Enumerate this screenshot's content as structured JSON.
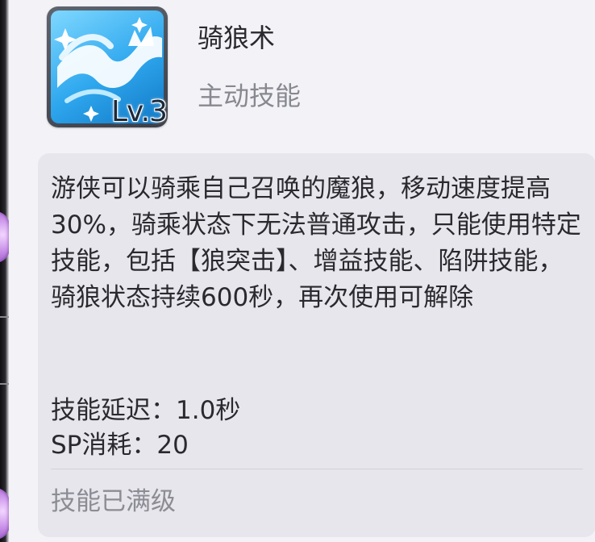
{
  "skill": {
    "icon": "wolf-ride-icon",
    "level": "Lv.3",
    "name": "骑狼术",
    "type": "主动技能"
  },
  "description": "游侠可以骑乘自己召唤的魔狼，移动速度提高30%，骑乘状态下无法普通攻击，只能使用特定技能，包括【狼突击】、增益技能、陷阱技能，骑狼状态持续600秒，再次使用可解除",
  "stats": {
    "delay": "技能延迟：1.0秒",
    "sp": "SP消耗：20"
  },
  "status": "技能已满级",
  "colors": {
    "icon_blue": "#2ea7ee",
    "panel_bg": "#f3f3f7",
    "desc_bg": "#e6e6ec",
    "muted_text": "#888890"
  }
}
